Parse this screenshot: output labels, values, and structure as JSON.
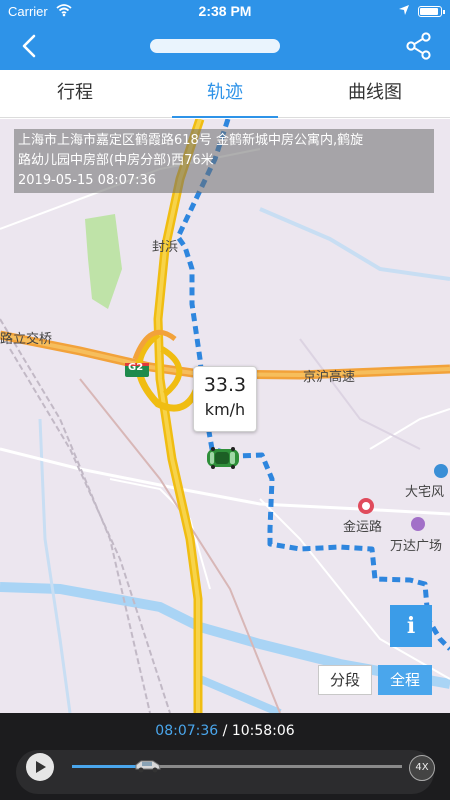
{
  "status": {
    "carrier": "Carrier",
    "time": "2:38 PM"
  },
  "nav": {
    "title_redacted": true
  },
  "tabs": [
    {
      "label": "行程",
      "active": false
    },
    {
      "label": "轨迹",
      "active": true
    },
    {
      "label": "曲线图",
      "active": false
    }
  ],
  "map": {
    "address_line1": "上海市上海市嘉定区鹤霞路618号 金鹤新城中房公寓内,鹤旋",
    "address_line2": "路幼儿园中房部(中房分部)西76米",
    "timestamp": "2019-05-15 08:07:36",
    "speed_value": "33.3",
    "speed_unit": "km/h",
    "labels": {
      "fenghai": "封浜",
      "lijiao": "路立交桥",
      "g2": "G2",
      "jinghu": "京沪高速",
      "dazhai": "大宅风",
      "jinyun": "金运路",
      "wanda": "万达广场"
    },
    "info_btn": "i",
    "seg_btn": "分段",
    "all_btn": "全程"
  },
  "player": {
    "current": "08:07:36",
    "separator": " / ",
    "total": "10:58:06",
    "progress": 0.23,
    "speed": "4X"
  },
  "colors": {
    "accent": "#2e93e8",
    "route": "#2e86de",
    "highway": "#f5c518",
    "road_orange": "#f2a23a"
  }
}
